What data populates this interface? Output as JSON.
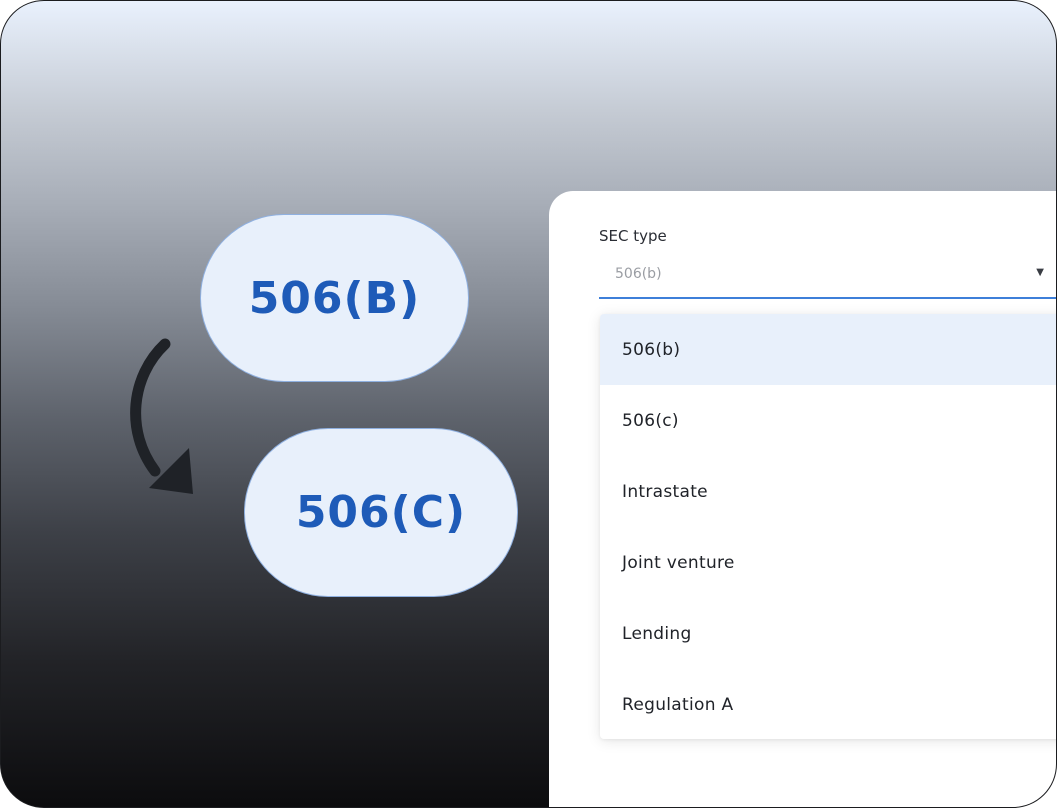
{
  "pills": {
    "from_label": "506(B)",
    "to_label": "506(C)"
  },
  "form": {
    "field_label": "SEC type",
    "select_value": "506(b)",
    "caret_icon": "dropdown-caret-icon",
    "options": [
      {
        "label": "506(b)",
        "selected": true
      },
      {
        "label": "506(c)",
        "selected": false
      },
      {
        "label": "Intrastate",
        "selected": false
      },
      {
        "label": "Joint venture",
        "selected": false
      },
      {
        "label": "Lending",
        "selected": false
      },
      {
        "label": "Regulation A",
        "selected": false
      }
    ]
  },
  "colors": {
    "accent_blue": "#3d7fd9",
    "pill_text": "#1e5bb8",
    "pill_fill": "#e8f0fb",
    "selected_option_bg": "#e8f0fb"
  }
}
